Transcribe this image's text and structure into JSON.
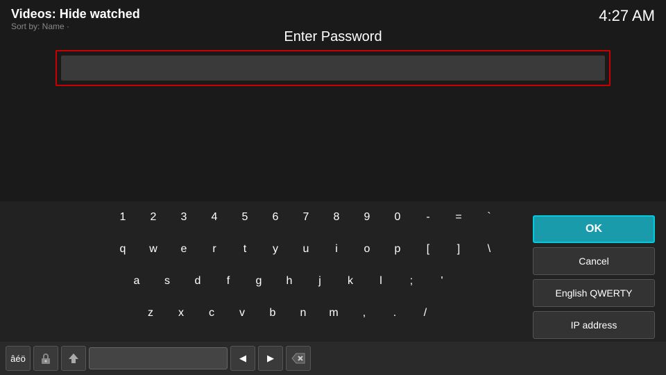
{
  "header": {
    "title": "Videos: Hide watched",
    "subtitle": "Sort by: Name ·"
  },
  "clock": "4:27 AM",
  "dialog": {
    "title": "Enter Password",
    "password_value": ""
  },
  "keyboard": {
    "row1": [
      "1",
      "2",
      "3",
      "4",
      "5",
      "6",
      "7",
      "8",
      "9",
      "0",
      "-",
      "=",
      "`"
    ],
    "row2": [
      "q",
      "w",
      "e",
      "r",
      "t",
      "y",
      "u",
      "i",
      "o",
      "p",
      "[",
      "]",
      "\\"
    ],
    "row3": [
      "a",
      "s",
      "d",
      "f",
      "g",
      "h",
      "j",
      "k",
      "l",
      ";",
      "'"
    ],
    "row4": [
      "z",
      "x",
      "c",
      "v",
      "b",
      "n",
      "m",
      ",",
      ".",
      "/"
    ]
  },
  "side_buttons": {
    "ok": "OK",
    "cancel": "Cancel",
    "layout": "English QWERTY",
    "ip": "IP address"
  },
  "toolbar": {
    "special_chars": "âéö",
    "shift_icon": "⇧",
    "caps_icon": "⬆",
    "backspace_icon": "⌫",
    "left_arrow": "◀",
    "right_arrow": "▶",
    "delete_icon": "✕"
  }
}
